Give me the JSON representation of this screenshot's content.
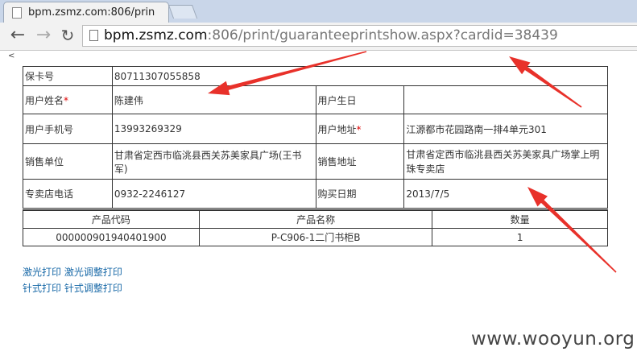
{
  "browser": {
    "tab_title": "bpm.zsmz.com:806/prin",
    "url_host": "bpm.zsmz.com",
    "url_rest": ":806/print/guaranteeprintshow.aspx?cardid=38439"
  },
  "collapse_marker": "<",
  "info": {
    "card_no_label": "保卡号",
    "card_no": "80711307055858",
    "name_label": "用户姓名",
    "name": "陈建伟",
    "birthday_label": "用户生日",
    "birthday": "",
    "phone_label": "用户手机号",
    "phone": "13993269329",
    "address_label": "用户地址",
    "address": "江源都市花园路南一排4单元301",
    "seller_label": "销售单位",
    "seller": "甘肃省定西市临洮县西关苏美家具广场(王书军)",
    "seller_addr_label": "销售地址",
    "seller_addr": "甘肃省定西市临洮县西关苏美家具广场掌上明珠专卖店",
    "store_phone_label": "专卖店电话",
    "store_phone": "0932-2246127",
    "purchase_date_label": "购买日期",
    "purchase_date": "2013/7/5",
    "required_mark": "*"
  },
  "products": {
    "headers": [
      "产品代码",
      "产品名称",
      "数量"
    ],
    "rows": [
      [
        "000000901940401900",
        "P-C906-1二门书柜B",
        "1"
      ]
    ]
  },
  "links": {
    "laser_print": "激光打印",
    "laser_adjust": "激光调整打印",
    "dot_print": "针式打印",
    "dot_adjust": "针式调整打印"
  },
  "watermark": "www.wooyun.org",
  "annotation_color": "#e8312a"
}
